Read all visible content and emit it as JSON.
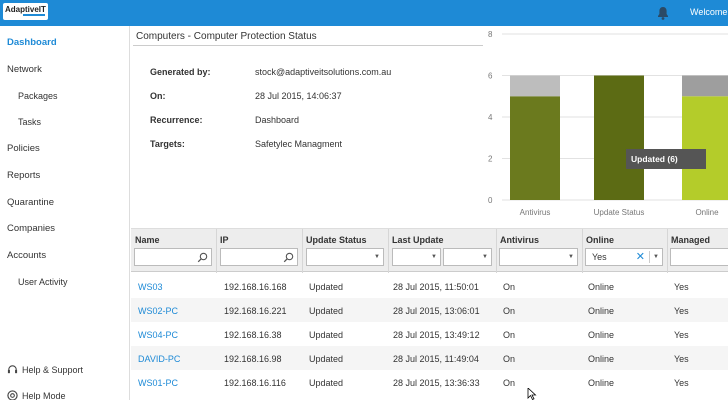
{
  "header": {
    "logo_text": "AdaptiveIT",
    "welcome": "Welcome,",
    "colors": {
      "topbar": "#1e8ad6",
      "accent": "#1e8ad6"
    }
  },
  "sidebar": {
    "items": [
      {
        "label": "Dashboard",
        "active": true
      },
      {
        "label": "Network"
      },
      {
        "label": "Packages"
      },
      {
        "label": "Tasks"
      },
      {
        "label": "Policies"
      },
      {
        "label": "Reports"
      },
      {
        "label": "Quarantine"
      },
      {
        "label": "Companies"
      },
      {
        "label": "Accounts"
      },
      {
        "label": "User Activity"
      }
    ],
    "footer": [
      {
        "label": "Help & Support",
        "icon": "headset-icon"
      },
      {
        "label": "Help Mode",
        "icon": "lifebuoy-icon"
      }
    ]
  },
  "report": {
    "title": "Computers - Computer Protection Status",
    "meta": [
      {
        "label": "Generated by:",
        "value": "stock@adaptiveitsolutions.com.au"
      },
      {
        "label": "On:",
        "value": "28 Jul 2015, 14:06:37"
      },
      {
        "label": "Recurrence:",
        "value": "Dashboard"
      },
      {
        "label": "Targets:",
        "value": "Safetylec Managment"
      }
    ]
  },
  "chart_data": {
    "type": "bar",
    "stacked": true,
    "categories": [
      "Antivirus",
      "Update Status",
      "Online"
    ],
    "ylim": [
      0,
      8
    ],
    "yticks": [
      0,
      2,
      4,
      6,
      8
    ],
    "grid": true,
    "series": [
      {
        "values": [
          5,
          6,
          5
        ],
        "colors": [
          "#6b7a1e",
          "#5c6b14",
          "#b4cc2a"
        ]
      },
      {
        "values": [
          1,
          0,
          1
        ],
        "colors": [
          "#bdbdbd",
          "#bdbdbd",
          "#9e9e9e"
        ]
      }
    ],
    "tooltip": {
      "text": "Updated (6)",
      "category": "Update Status"
    }
  },
  "grid": {
    "columns": [
      {
        "label": "Name",
        "filter": "search"
      },
      {
        "label": "IP",
        "filter": "search"
      },
      {
        "label": "Update Status",
        "filter": "select"
      },
      {
        "label": "Last Update",
        "filter": "date-range"
      },
      {
        "label": "Antivirus",
        "filter": "select"
      },
      {
        "label": "Online",
        "filter": "select",
        "value": "Yes"
      },
      {
        "label": "Managed",
        "filter": "select"
      }
    ],
    "rows": [
      [
        "WS03",
        "192.168.16.168",
        "Updated",
        "28 Jul 2015, 11:50:01",
        "On",
        "Online",
        "Yes"
      ],
      [
        "WS02-PC",
        "192.168.16.221",
        "Updated",
        "28 Jul 2015, 13:06:01",
        "On",
        "Online",
        "Yes"
      ],
      [
        "WS04-PC",
        "192.168.16.38",
        "Updated",
        "28 Jul 2015, 13:49:12",
        "On",
        "Online",
        "Yes"
      ],
      [
        "DAVID-PC",
        "192.168.16.98",
        "Updated",
        "28 Jul 2015, 11:49:04",
        "On",
        "Online",
        "Yes"
      ],
      [
        "WS01-PC",
        "192.168.16.116",
        "Updated",
        "28 Jul 2015, 13:36:33",
        "On",
        "Online",
        "Yes"
      ]
    ]
  }
}
